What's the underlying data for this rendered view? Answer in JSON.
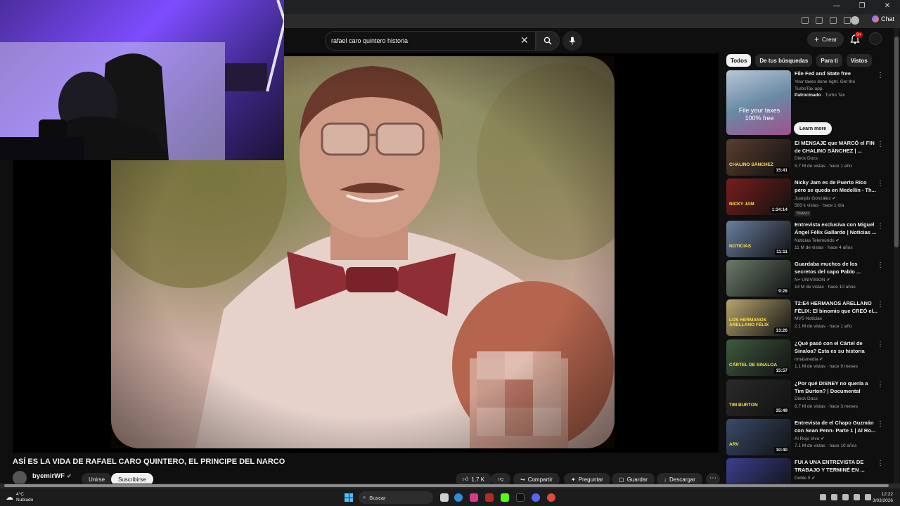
{
  "search": {
    "query": "rafael caro quintero historia"
  },
  "header": {
    "create_label": "Crear",
    "notif_badge": "9+"
  },
  "browser": {
    "chat_label": "Chat"
  },
  "video": {
    "title": "ASÍ ES LA VIDA DE RAFAEL CARO QUINTERO, EL PRINCIPE DEL NARCO",
    "channel": "byemirWF",
    "actions": {
      "join": "Unirse",
      "subscribe": "Suscribirse",
      "likes": "1.7 K",
      "share": "Compartir",
      "ask": "Preguntar",
      "save": "Guardar",
      "download": "Descargar"
    }
  },
  "chips": [
    "Todos",
    "De tus búsquedas",
    "Para ti",
    "Vistos"
  ],
  "ad": {
    "title": "File Fed and State free",
    "desc": "Your taxes done right. Get the TurboTax app.",
    "sponsored": "Patrocinado",
    "advertiser": "Turbo Tax",
    "thumb_text": "File your taxes 100% free",
    "cta": "Learn more"
  },
  "recommendations": [
    {
      "title": "El MENSAJE que MARCÓ el FIN de CHALINO SÁNCHEZ | ...",
      "channel": "Dieck Docs",
      "meta": "5.7 M de vistas · hace 1 año",
      "duration": "15:41",
      "thumb_text": "CHALINO SÁNCHEZ",
      "color": "#5a3d2e",
      "verified": false
    },
    {
      "title": "Nicky Jam es de Puerto Rico pero se queda en Medellín - Th...",
      "channel": "Juanpis González",
      "meta": "583 k vistas · hace 1 día",
      "duration": "1:34:14",
      "thumb_text": "NICKY JAM",
      "color": "#7a1d1d",
      "verified": true,
      "badge": "Nuevo"
    },
    {
      "title": "Entrevista exclusiva con Miguel Ángel Félix Gallardo | Noticias ...",
      "channel": "Noticias Telemundo",
      "meta": "11 M de vistas · hace 4 años",
      "duration": "11:11",
      "thumb_text": "NOTICIAS",
      "color": "#6a7fa0",
      "verified": true
    },
    {
      "title": "Guardaba muchos de los secretos del capo Pablo ...",
      "channel": "N+ UNIVISION",
      "meta": "14 M de vistas · hace 10 años",
      "duration": "9:28",
      "thumb_text": "",
      "color": "#6b7b6a",
      "verified": true
    },
    {
      "title": "T2:E4 HERMANOS ARELLANO FÉLIX: El binomio que CREÓ el...",
      "channel": "MVS Noticias",
      "meta": "2.1 M de vistas · hace 1 año",
      "duration": "13:26",
      "thumb_text": "LOS HERMANOS ARELLANO FÉLIX",
      "color": "#b8a56e",
      "verified": false
    },
    {
      "title": "¿Qué pasó con el Cártel de Sinaloa? Esta es su historia",
      "channel": "nmásmedia",
      "meta": "1.1 M de vistas · hace 9 meses",
      "duration": "15:57",
      "thumb_text": "CÁRTEL DE SINALOA",
      "color": "#3f5a3f",
      "verified": true
    },
    {
      "title": "¿Por qué DISNEY no quería a Tim Burton? | Documental",
      "channel": "Dieck Docs",
      "meta": "6.7 M de vistas · hace 3 meses",
      "duration": "35:49",
      "thumb_text": "TIM BURTON",
      "color": "#2a2a2a",
      "verified": false
    },
    {
      "title": "Entrevista de el Chapo Guzmán con Sean Penn- Parte 1 | Al Ro...",
      "channel": "Al Rojo Vivo",
      "meta": "7.1 M de vistas · hace 10 años",
      "duration": "10:40",
      "thumb_text": "ARV",
      "color": "#3a4b6a",
      "verified": true
    },
    {
      "title": "FUI A UNA ENTREVISTA DE TRABAJO Y TERMINÉ EN ...",
      "channel": "Doble 0",
      "meta": "",
      "duration": "",
      "thumb_text": "",
      "color": "#3b3f8f",
      "verified": true
    }
  ],
  "taskbar": {
    "weather_temp": "4°C",
    "weather_desc": "Nublado",
    "search_label": "Buscar",
    "time": "12:22",
    "date": "3/03/2026"
  }
}
